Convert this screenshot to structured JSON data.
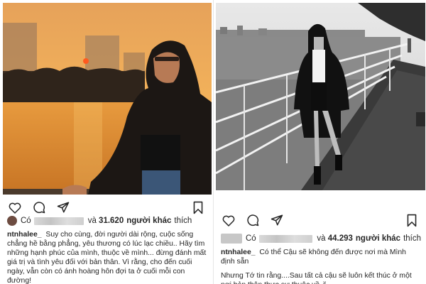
{
  "posts": [
    {
      "username": "ntnhalee_",
      "likes_prefix": "Có",
      "likes_count": "31.620",
      "likes_suffix": "người khác",
      "likes_verb": "thích",
      "caption": [
        "Suy cho cùng, đời người dài rộng, cuộc sống chẳng hề bằng phẳng, yêu thương có lúc lạc chiều.. Hãy tìm những hạnh phúc của mình, thuộc về mình... đừng đánh mất giá trị và tình yêu đối với bản thân. Vì rằng, cho đến cuối ngày, vẫn còn có ánh hoàng hôn đợi ta ở cuối mỗi con đường!"
      ]
    },
    {
      "username": "ntnhalee_",
      "likes_prefix": "Có",
      "likes_count": "44.293",
      "likes_suffix": "người khác",
      "likes_verb": "thích",
      "caption": [
        "Có thể Cậu sẽ không đến được nơi mà Mình định sẵn",
        "Nhưng Tớ tin rằng....Sau tất cả cậu sẽ luôn kết thúc ở một nơi bản thân thực sự thuộc về ✌"
      ]
    }
  ],
  "icons": [
    "heart-icon",
    "comment-icon",
    "share-icon",
    "bookmark-icon"
  ],
  "colors": {
    "text": "#262626",
    "divider": "#e6e6e6",
    "sunset": "#f0a23c"
  }
}
